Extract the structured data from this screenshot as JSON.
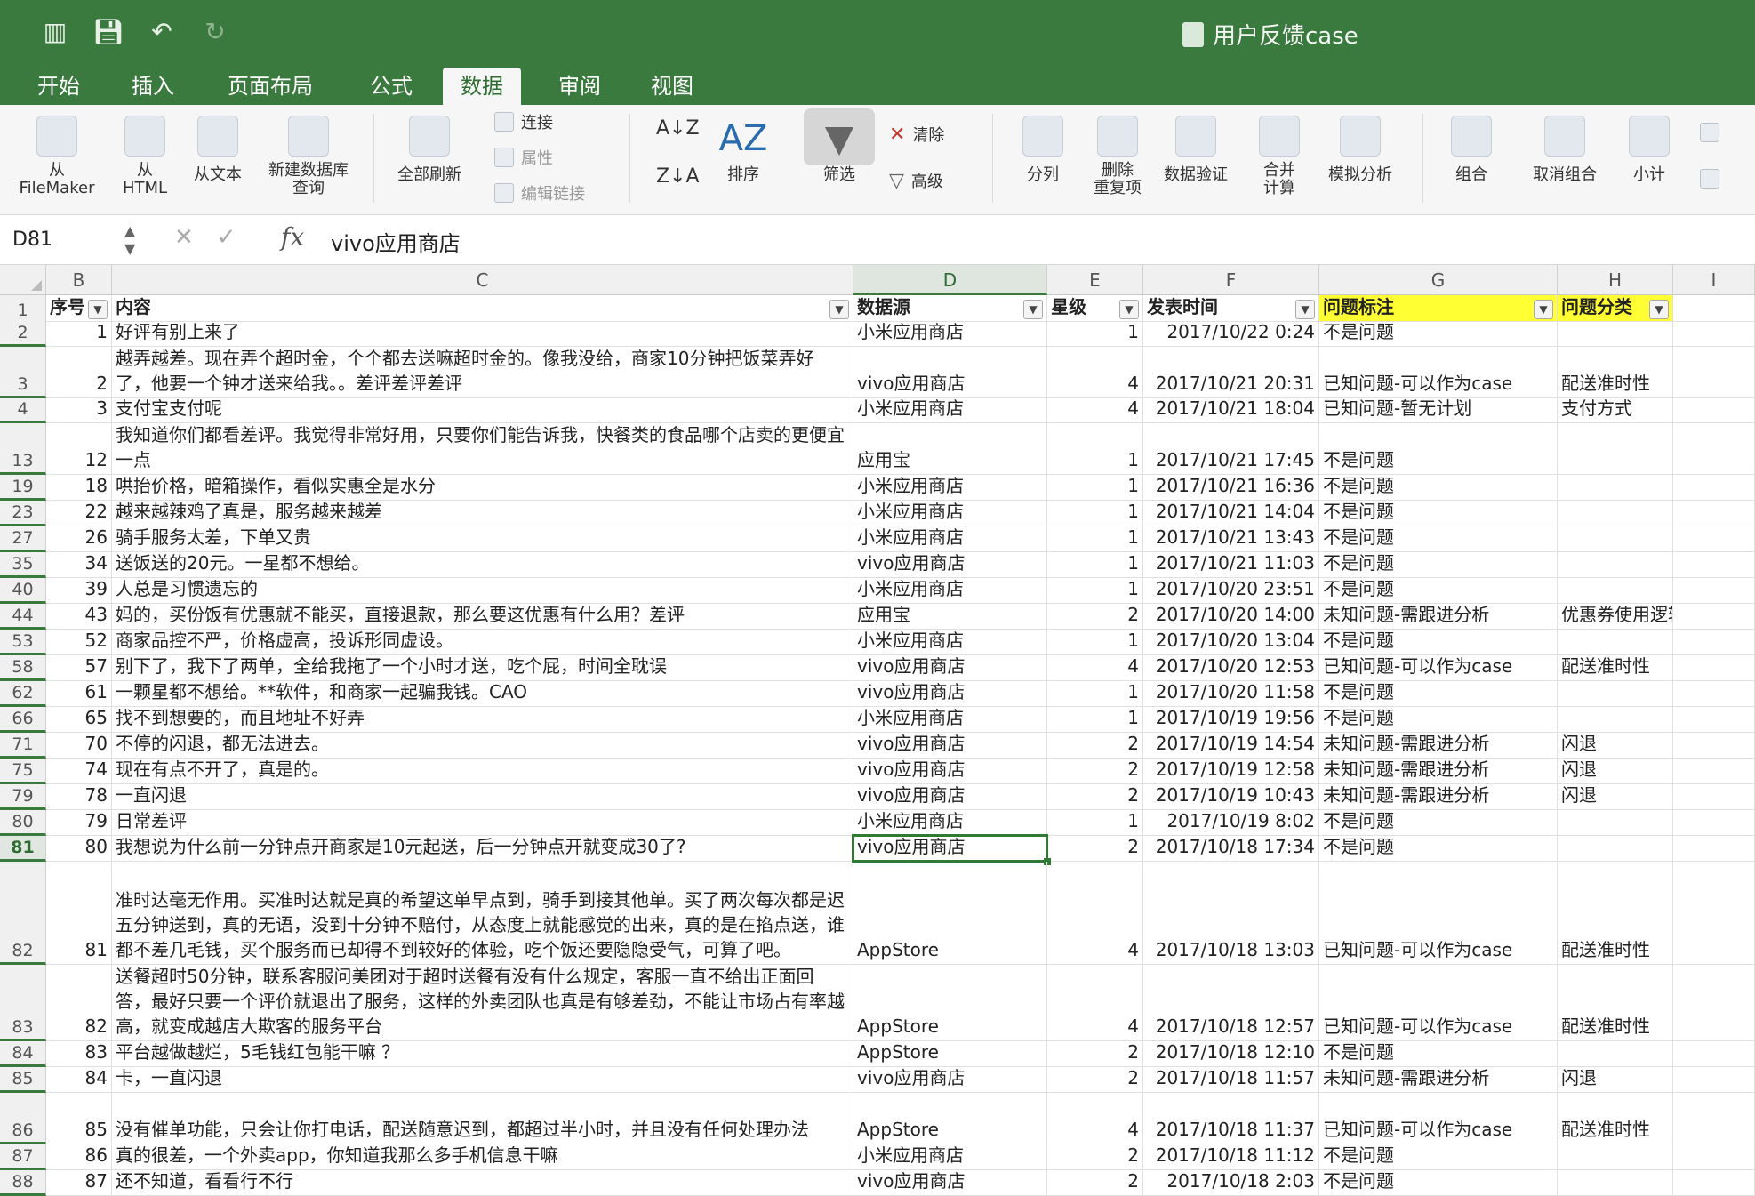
{
  "window": {
    "title": "用户反馈case"
  },
  "quick_access": [
    "sidebar-toggle",
    "save",
    "undo",
    "redo"
  ],
  "tabs": [
    "开始",
    "插入",
    "页面布局",
    "公式",
    "数据",
    "审阅",
    "视图"
  ],
  "active_tab": "数据",
  "ribbon": {
    "from_filemaker": "从\nFileMaker",
    "from_html": "从\nHTML",
    "from_text": "从文本",
    "new_db_query": "新建数据库\n查询",
    "refresh_all": "全部刷新",
    "connections": "连接",
    "properties": "属性",
    "edit_links": "编辑链接",
    "sort": "排序",
    "filter": "筛选",
    "clear": "清除",
    "advanced": "高级",
    "text_to_columns": "分列",
    "remove_duplicates": "删除\n重复项",
    "data_validation": "数据验证",
    "consolidate": "合并\n计算",
    "what_if": "模拟分析",
    "group": "组合",
    "ungroup": "取消组合",
    "subtotal": "小计"
  },
  "formula_bar": {
    "name_box": "D81",
    "value": "vivo应用商店"
  },
  "columns": [
    "B",
    "C",
    "D",
    "E",
    "F",
    "G",
    "H",
    "I"
  ],
  "header_row": {
    "row": "1",
    "b": "序号",
    "c": "内容",
    "d": "数据源",
    "e": "星级",
    "f": "发表时间",
    "g": "问题标注",
    "h": "问题分类"
  },
  "rows": [
    {
      "r": "2",
      "b": "1",
      "c": "好评有别上来了",
      "d": "小米应用商店",
      "e": "1",
      "f": "2017/10/22 0:24",
      "g": "不是问题",
      "h": ""
    },
    {
      "r": "3",
      "b": "2",
      "c": "越弄越差。现在弄个超时金，个个都去送嘛超时金的。像我没给，商家10分钟把饭菜弄好了，他要一个钟才送来给我。。差评差评差评",
      "d": "vivo应用商店",
      "e": "4",
      "f": "2017/10/21 20:31",
      "g": "已知问题-可以作为case",
      "h": "配送准时性"
    },
    {
      "r": "4",
      "b": "3",
      "c": "支付宝支付呢",
      "d": "小米应用商店",
      "e": "4",
      "f": "2017/10/21 18:04",
      "g": "已知问题-暂无计划",
      "h": "支付方式"
    },
    {
      "r": "13",
      "b": "12",
      "c": "我知道你们都看差评。我觉得非常好用，只要你们能告诉我，快餐类的食品哪个店卖的更便宜一点",
      "d": "应用宝",
      "e": "1",
      "f": "2017/10/21 17:45",
      "g": "不是问题",
      "h": ""
    },
    {
      "r": "19",
      "b": "18",
      "c": "哄抬价格，暗箱操作，看似实惠全是水分",
      "d": "小米应用商店",
      "e": "1",
      "f": "2017/10/21 16:36",
      "g": "不是问题",
      "h": ""
    },
    {
      "r": "23",
      "b": "22",
      "c": "越来越辣鸡了真是，服务越来越差",
      "d": "小米应用商店",
      "e": "1",
      "f": "2017/10/21 14:04",
      "g": "不是问题",
      "h": ""
    },
    {
      "r": "27",
      "b": "26",
      "c": "骑手服务太差，下单又贵",
      "d": "小米应用商店",
      "e": "1",
      "f": "2017/10/21 13:43",
      "g": "不是问题",
      "h": ""
    },
    {
      "r": "35",
      "b": "34",
      "c": "送饭送的20元。一星都不想给。",
      "d": "vivo应用商店",
      "e": "1",
      "f": "2017/10/21 11:03",
      "g": "不是问题",
      "h": ""
    },
    {
      "r": "40",
      "b": "39",
      "c": "人总是习惯遗忘的",
      "d": "小米应用商店",
      "e": "1",
      "f": "2017/10/20 23:51",
      "g": "不是问题",
      "h": ""
    },
    {
      "r": "44",
      "b": "43",
      "c": "妈的，买份饭有优惠就不能买，直接退款，那么要这优惠有什么用？差评",
      "d": "应用宝",
      "e": "2",
      "f": "2017/10/20 14:00",
      "g": "未知问题-需跟进分析",
      "h": "优惠券使用逻辑"
    },
    {
      "r": "53",
      "b": "52",
      "c": "商家品控不严，价格虚高，投诉形同虚设。",
      "d": "小米应用商店",
      "e": "1",
      "f": "2017/10/20 13:04",
      "g": "不是问题",
      "h": ""
    },
    {
      "r": "58",
      "b": "57",
      "c": "别下了，我下了两单，全给我拖了一个小时才送，吃个屁，时间全耽误",
      "d": "vivo应用商店",
      "e": "4",
      "f": "2017/10/20 12:53",
      "g": "已知问题-可以作为case",
      "h": "配送准时性"
    },
    {
      "r": "62",
      "b": "61",
      "c": "一颗星都不想给。**软件，和商家一起骗我钱。CAO",
      "d": "vivo应用商店",
      "e": "1",
      "f": "2017/10/20 11:58",
      "g": "不是问题",
      "h": ""
    },
    {
      "r": "66",
      "b": "65",
      "c": "找不到想要的，而且地址不好弄",
      "d": "小米应用商店",
      "e": "1",
      "f": "2017/10/19 19:56",
      "g": "不是问题",
      "h": ""
    },
    {
      "r": "71",
      "b": "70",
      "c": "不停的闪退，都无法进去。",
      "d": "vivo应用商店",
      "e": "2",
      "f": "2017/10/19 14:54",
      "g": "未知问题-需跟进分析",
      "h": "闪退"
    },
    {
      "r": "75",
      "b": "74",
      "c": "现在有点不开了，真是的。",
      "d": "vivo应用商店",
      "e": "2",
      "f": "2017/10/19 12:58",
      "g": "未知问题-需跟进分析",
      "h": "闪退"
    },
    {
      "r": "79",
      "b": "78",
      "c": "一直闪退",
      "d": "vivo应用商店",
      "e": "2",
      "f": "2017/10/19 10:43",
      "g": "未知问题-需跟进分析",
      "h": "闪退"
    },
    {
      "r": "80",
      "b": "79",
      "c": "日常差评",
      "d": "小米应用商店",
      "e": "1",
      "f": "2017/10/19 8:02",
      "g": "不是问题",
      "h": ""
    },
    {
      "r": "81",
      "b": "80",
      "c": "我想说为什么前一分钟点开商家是10元起送，后一分钟点开就变成30了?",
      "d": "vivo应用商店",
      "e": "2",
      "f": "2017/10/18 17:34",
      "g": "不是问题",
      "h": ""
    },
    {
      "r": "82",
      "b": "81",
      "c": "准时达毫无作用。买准时达就是真的希望这单早点到，骑手到接其他单。买了两次每次都是迟五分钟送到，真的无语，没到十分钟不赔付，从态度上就能感觉的出来，真的是在掐点送，谁都不差几毛钱，买个服务而已却得不到较好的体验，吃个饭还要隐隐受气，可算了吧。",
      "d": "AppStore",
      "e": "4",
      "f": "2017/10/18 13:03",
      "g": "已知问题-可以作为case",
      "h": "配送准时性"
    },
    {
      "r": "83",
      "b": "82",
      "c": "送餐超时50分钟，联系客服问美团对于超时送餐有没有什么规定，客服一直不给出正面回答，最好只要一个评价就退出了服务，这样的外卖团队也真是有够差劲，不能让市场占有率越高，就变成越店大欺客的服务平台",
      "d": "AppStore",
      "e": "4",
      "f": "2017/10/18 12:57",
      "g": "已知问题-可以作为case",
      "h": "配送准时性"
    },
    {
      "r": "84",
      "b": "83",
      "c": "平台越做越烂，5毛钱红包能干嘛 ？",
      "d": "AppStore",
      "e": "2",
      "f": "2017/10/18 12:10",
      "g": "不是问题",
      "h": ""
    },
    {
      "r": "85",
      "b": "84",
      "c": "卡，一直闪退",
      "d": "vivo应用商店",
      "e": "2",
      "f": "2017/10/18 11:57",
      "g": "未知问题-需跟进分析",
      "h": "闪退"
    },
    {
      "r": "86",
      "b": "85",
      "c": "没有催单功能，只会让你打电话，配送随意迟到，都超过半小时，并且没有任何处理办法",
      "d": "AppStore",
      "e": "4",
      "f": "2017/10/18 11:37",
      "g": "已知问题-可以作为case",
      "h": "配送准时性"
    },
    {
      "r": "87",
      "b": "86",
      "c": "真的很差，一个外卖app，你知道我那么多手机信息干嘛",
      "d": "小米应用商店",
      "e": "2",
      "f": "2017/10/18 11:12",
      "g": "不是问题",
      "h": ""
    },
    {
      "r": "88",
      "b": "87",
      "c": "还不知道，看看行不行",
      "d": "vivo应用商店",
      "e": "2",
      "f": "2017/10/18 2:03",
      "g": "不是问题",
      "h": ""
    }
  ],
  "colors": {
    "accent": "#3a7a3e",
    "highlight": "#ffff33"
  }
}
